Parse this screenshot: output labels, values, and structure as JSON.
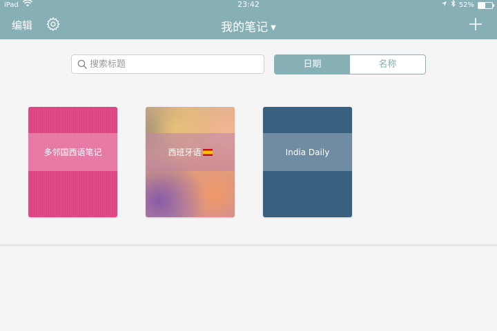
{
  "status_bar": {
    "device": "iPad",
    "time": "23:42",
    "battery_percent": "52%",
    "battery_level": 0.52
  },
  "nav": {
    "edit_label": "编辑",
    "title": "我的笔记",
    "settings_icon": "gear-icon",
    "add_icon": "plus-icon"
  },
  "search": {
    "placeholder": "搜索标题",
    "value": ""
  },
  "sort": {
    "options": [
      "日期",
      "名称"
    ],
    "selected": "日期"
  },
  "notebooks": [
    {
      "title": "多邻国西语笔记",
      "color": "#e04a86"
    },
    {
      "title": "西班牙语",
      "cover": "watercolor",
      "emoji": "spain-flag"
    },
    {
      "title": "India Daily",
      "color": "#3a6280"
    }
  ],
  "colors": {
    "accent": "#86afb6",
    "background": "#f5f5f5"
  }
}
